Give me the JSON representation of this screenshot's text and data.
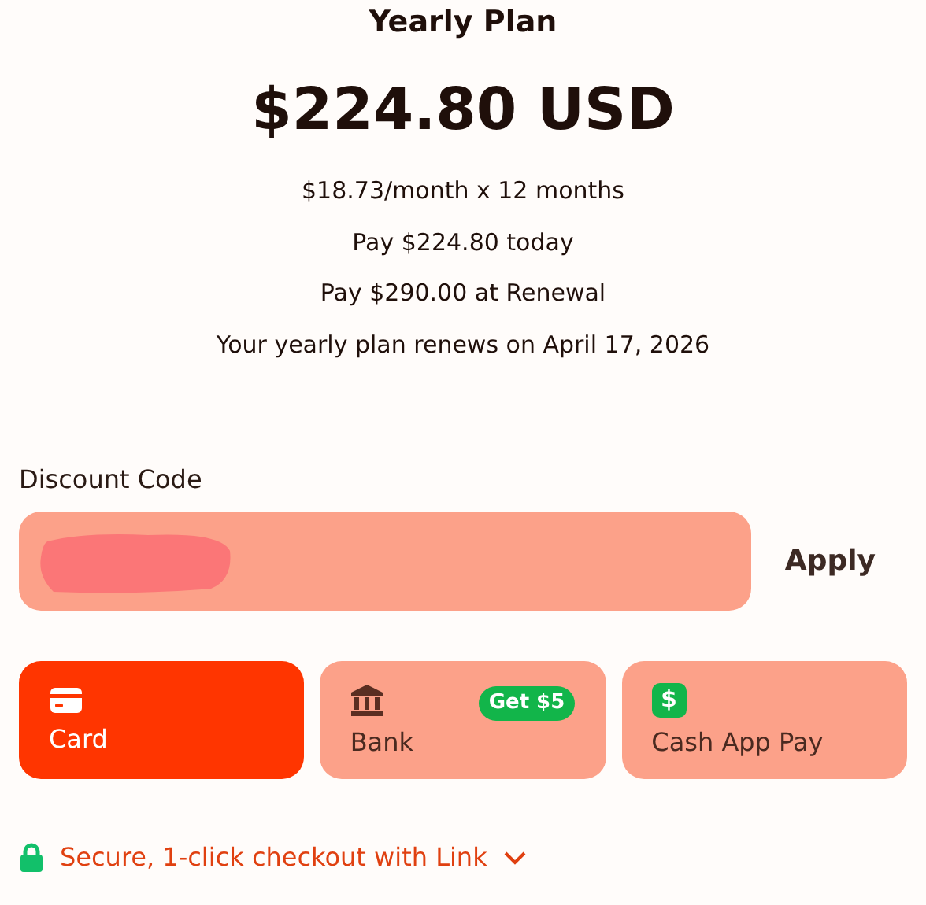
{
  "plan": {
    "title": "Yearly Plan",
    "price": "$224.80 USD",
    "details": [
      "$18.73/month x 12 months",
      "Pay $224.80 today",
      "Pay $290.00 at Renewal",
      "Your yearly plan renews on April 17, 2026"
    ]
  },
  "discount": {
    "label": "Discount Code",
    "redacted": true,
    "apply": "Apply"
  },
  "payment_methods": [
    {
      "kind": "card",
      "label": "Card",
      "selected": true
    },
    {
      "kind": "bank",
      "label": "Bank",
      "selected": false,
      "badge": "Get $5"
    },
    {
      "kind": "cashapp",
      "label": "Cash App Pay",
      "selected": false,
      "icon_glyph": "$"
    }
  ],
  "link": {
    "label": "Secure, 1-click checkout with Link",
    "expanded": false
  }
}
